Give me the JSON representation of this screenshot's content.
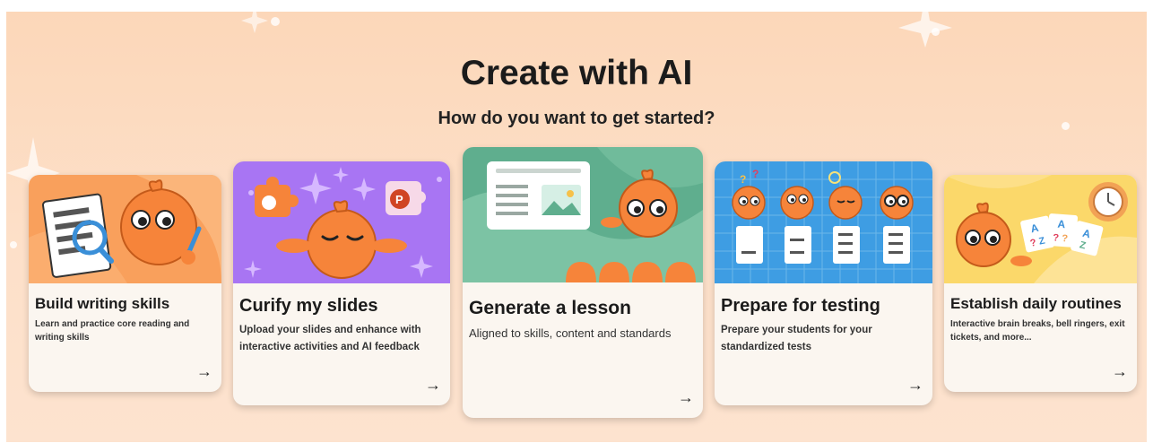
{
  "header": {
    "title": "Create with AI",
    "subtitle": "How do you want to get started?"
  },
  "cards": [
    {
      "title": "Build writing skills",
      "description": "Learn and practice core reading and writing skills",
      "arrow": "→"
    },
    {
      "title": "Curify my slides",
      "description": "Upload your slides and enhance with interactive activities and AI feedback",
      "arrow": "→"
    },
    {
      "title": "Generate a lesson",
      "description": "Aligned to skills, content and standards",
      "arrow": "→"
    },
    {
      "title": "Prepare for testing",
      "description": "Prepare your students for your standardized tests",
      "arrow": "→"
    },
    {
      "title": "Establish daily routines",
      "description": "Interactive brain breaks, bell ringers, exit tickets, and more...",
      "arrow": "→"
    }
  ],
  "illustrations": {
    "powerpoint_badge": "P",
    "flashcard_letters": [
      "A",
      "A",
      "A",
      "Z",
      "?",
      "?",
      "Z",
      "?"
    ],
    "thinking_marks": [
      "?",
      "?"
    ]
  },
  "colors": {
    "banner": "#fcd9bd",
    "mascot": "#f6843a",
    "card": "#fbf6f0",
    "slides_bg": "#a875f3",
    "lesson_bg": "#5fae8e",
    "testing_bg": "#3e9de3",
    "routines_bg": "#fbd86a",
    "writing_bg": "#f9a05c"
  }
}
